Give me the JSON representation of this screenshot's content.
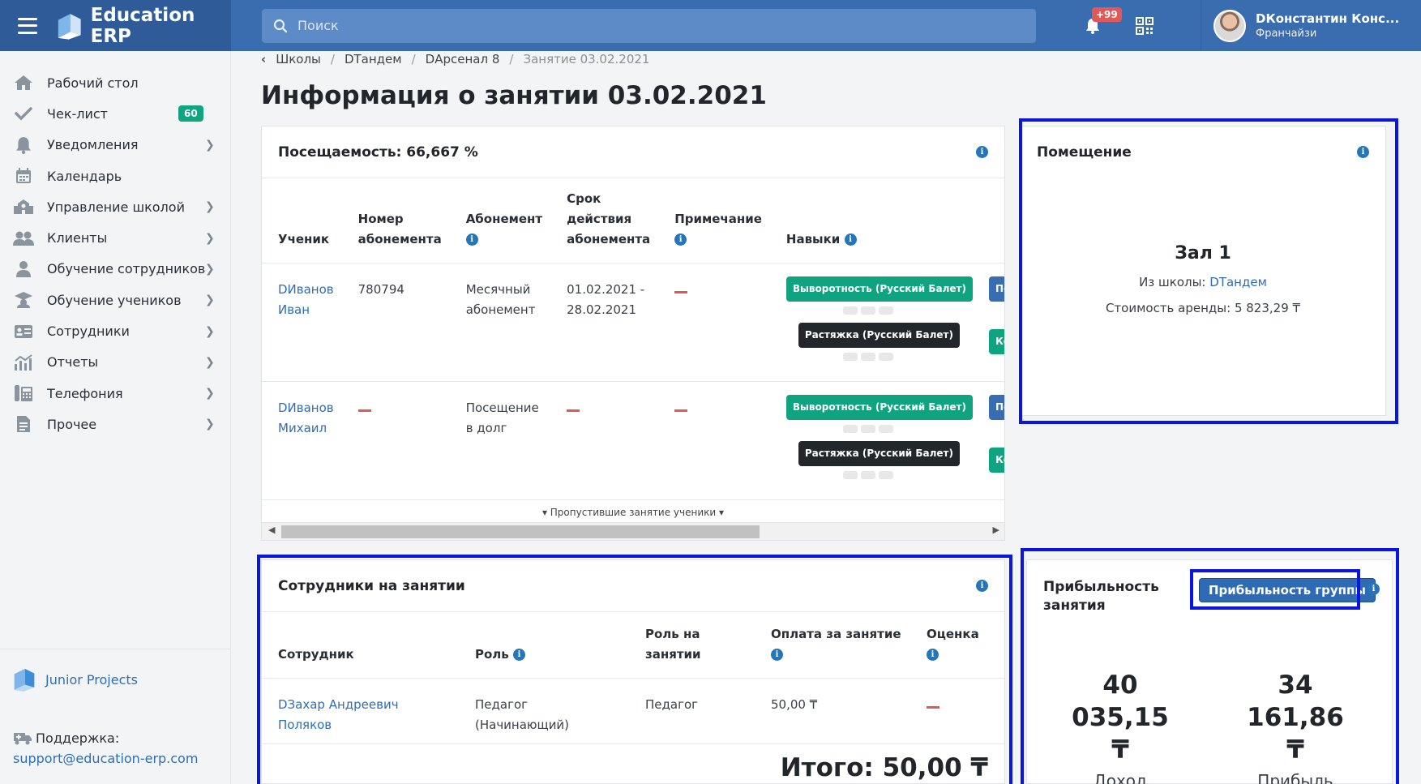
{
  "app": {
    "title": "Education ERP"
  },
  "search": {
    "placeholder": "Поиск"
  },
  "notifications": {
    "count": "+99"
  },
  "user": {
    "name": "DКонстантин Конс...",
    "role": "Франчайзи"
  },
  "sidebar": {
    "items": [
      {
        "label": "Рабочий стол",
        "icon": "home-icon"
      },
      {
        "label": "Чек-лист",
        "icon": "check-icon",
        "badge": "60"
      },
      {
        "label": "Уведомления",
        "icon": "bell-icon"
      },
      {
        "label": "Календарь",
        "icon": "calendar-icon"
      },
      {
        "label": "Управление школой",
        "icon": "school-icon"
      },
      {
        "label": "Клиенты",
        "icon": "users-icon"
      },
      {
        "label": "Обучение сотрудников",
        "icon": "user-graduate-icon"
      },
      {
        "label": "Обучение учеников",
        "icon": "graduation-cap-icon"
      },
      {
        "label": "Сотрудники",
        "icon": "id-card-icon"
      },
      {
        "label": "Отчеты",
        "icon": "chart-icon"
      },
      {
        "label": "Телефония",
        "icon": "phone-icon"
      },
      {
        "label": "Прочее",
        "icon": "document-icon"
      }
    ],
    "footer": {
      "project": "Junior Projects",
      "support_label": "Поддержка:",
      "support_email": "support@education-erp.com"
    }
  },
  "breadcrumb": {
    "items": [
      "Школы",
      "DТандем",
      "DАрсенал 8"
    ],
    "current": "Занятие 03.02.2021"
  },
  "page": {
    "title": "Информация о занятии 03.02.2021"
  },
  "attendance": {
    "title": "Посещаемость: 66,667 %",
    "headers": {
      "student": "Ученик",
      "number_l1": "Номер",
      "number_l2": "абонемента",
      "sub": "Абонемент",
      "term_l1": "Срок",
      "term_l2": "действия",
      "term_l3": "абонемента",
      "note": "Примечание",
      "skills": "Навыки"
    },
    "rows": [
      {
        "student_l1": "DИванов",
        "student_l2": "Иван",
        "number": "780794",
        "sub_l1": "Месячный",
        "sub_l2": "абонемент",
        "term_l1": "01.02.2021 -",
        "term_l2": "28.02.2021",
        "skill_a": "Выворотность (Русский Балет)",
        "skill_b": "Растяжка (Русский Балет)",
        "skill_c": "Постановк",
        "skill_d": "Координа"
      },
      {
        "student_l1": "DИванов",
        "student_l2": "Михаил",
        "sub_l1": "Посещение",
        "sub_l2": "в долг",
        "skill_a": "Выворотность (Русский Балет)",
        "skill_b": "Растяжка (Русский Балет)",
        "skill_c": "Постановк",
        "skill_d": "Координа"
      }
    ],
    "missed_toggle": "Пропустившие занятие ученики"
  },
  "room": {
    "title": "Помещение",
    "name": "Зал 1",
    "school_label": "Из школы:",
    "school_link": "DТандем",
    "rent": "Стоимость аренды: 5 823,29 ₸"
  },
  "staff": {
    "title": "Сотрудники на занятии",
    "headers": {
      "employee": "Сотрудник",
      "role": "Роль",
      "lesson_role_l1": "Роль на",
      "lesson_role_l2": "занятии",
      "pay": "Оплата за занятие",
      "rating": "Оценка"
    },
    "rows": [
      {
        "name_l1": "DЗахар Андреевич",
        "name_l2": "Поляков",
        "role_l1": "Педагог",
        "role_l2": "(Начинающий)",
        "lesson_role": "Педагог",
        "pay": "50,00 ₸"
      }
    ],
    "total": "Итого: 50,00 ₸"
  },
  "profit": {
    "title_l1": "Прибыльность",
    "title_l2": "занятия",
    "group_button": "Прибыльность группы",
    "income_value": "40 035,15",
    "income_currency": "₸",
    "income_label": "Доход",
    "profit_value": "34 161,86",
    "profit_currency": "₸",
    "profit_label": "Прибыль"
  },
  "colors": {
    "accent": "#3a6cb0",
    "success": "#10a37f",
    "danger": "#e25757",
    "highlight": "#0a16e0"
  }
}
